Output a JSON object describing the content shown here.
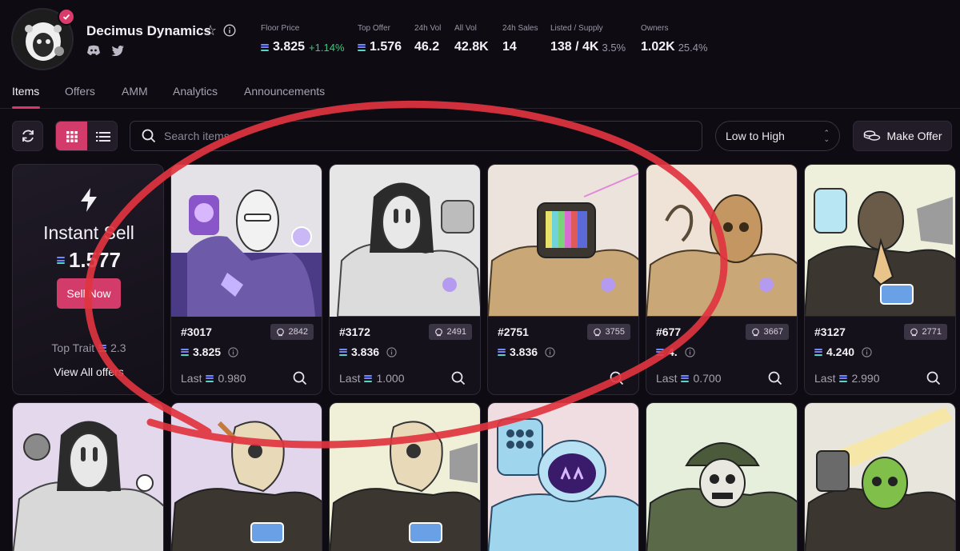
{
  "collection": {
    "name": "Decimus Dynamics"
  },
  "stats": [
    {
      "label": "Floor Price",
      "value": "3.825",
      "change": "+1.14%",
      "sol": true
    },
    {
      "label": "Top Offer",
      "value": "1.576",
      "sol": true
    },
    {
      "label": "24h Vol",
      "value": "46.2"
    },
    {
      "label": "All Vol",
      "value": "42.8K"
    },
    {
      "label": "24h Sales",
      "value": "14"
    },
    {
      "label": "Listed / Supply",
      "value": "138 / 4K",
      "sub": "3.5%"
    },
    {
      "label": "Owners",
      "value": "1.02K",
      "sub": "25.4%"
    }
  ],
  "tabs": [
    "Items",
    "Offers",
    "AMM",
    "Analytics",
    "Announcements"
  ],
  "toolbar": {
    "search_placeholder": "Search items",
    "sort_label": "Low to High",
    "make_offer_label": "Make Offer"
  },
  "instant_sell": {
    "title": "Instant Sell",
    "price": "1.577",
    "button_label": "Sell Now",
    "top_trait_label": "Top Trait",
    "top_trait_value": "2.3",
    "view_all_label": "View All offers"
  },
  "items": [
    {
      "id": "#3017",
      "rank": "2842",
      "price": "3.825",
      "last_label": "Last",
      "last": "0.980"
    },
    {
      "id": "#3172",
      "rank": "2491",
      "price": "3.836",
      "last_label": "Last",
      "last": "1.000"
    },
    {
      "id": "#2751",
      "rank": "3755",
      "price": "3.836",
      "last_label": "",
      "last": ""
    },
    {
      "id": "#677",
      "rank": "3667",
      "price": "4.",
      "last_label": "Last",
      "last": "0.700"
    },
    {
      "id": "#3127",
      "rank": "2771",
      "price": "4.240",
      "last_label": "Last",
      "last": "2.990"
    }
  ],
  "colors": {
    "accent": "#d33c6a",
    "background": "#0e0b12",
    "card": "#15111a",
    "annotation": "#e0343f",
    "positive": "#3ec77c"
  },
  "icons": [
    "verified-badge-icon",
    "star-icon",
    "info-icon",
    "discord-icon",
    "twitter-icon",
    "refresh-icon",
    "grid-icon",
    "list-icon",
    "search-icon",
    "sort-icon",
    "offer-coins-icon",
    "bolt-icon",
    "rarity-icon",
    "zoom-icon"
  ]
}
